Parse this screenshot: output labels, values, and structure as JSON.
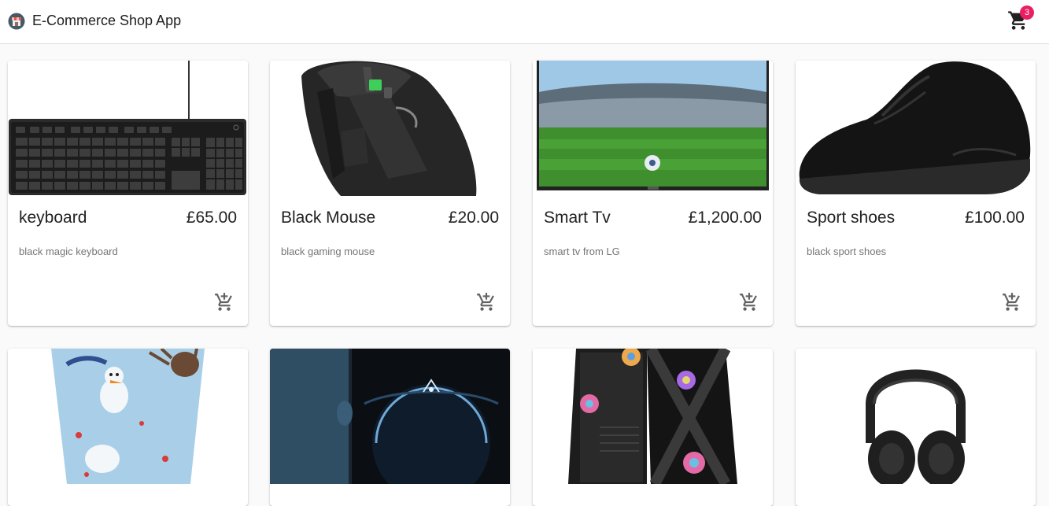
{
  "app": {
    "title": "E-Commerce Shop App",
    "cart_count": "3"
  },
  "products": [
    {
      "name": "keyboard",
      "price": "£65.00",
      "description": "black magic keyboard"
    },
    {
      "name": "Black Mouse",
      "price": "£20.00",
      "description": "black gaming mouse"
    },
    {
      "name": "Smart Tv",
      "price": "£1,200.00",
      "description": "smart tv from LG"
    },
    {
      "name": "Sport shoes",
      "price": "£100.00",
      "description": "black sport shoes"
    }
  ],
  "icons": {
    "logo": "shop-logo-icon",
    "cart": "shopping-cart-icon",
    "add_to_cart": "add-shopping-cart-icon"
  },
  "colors": {
    "badge": "#e91e63",
    "appbar": "#ffffff",
    "background": "#fafafa"
  }
}
